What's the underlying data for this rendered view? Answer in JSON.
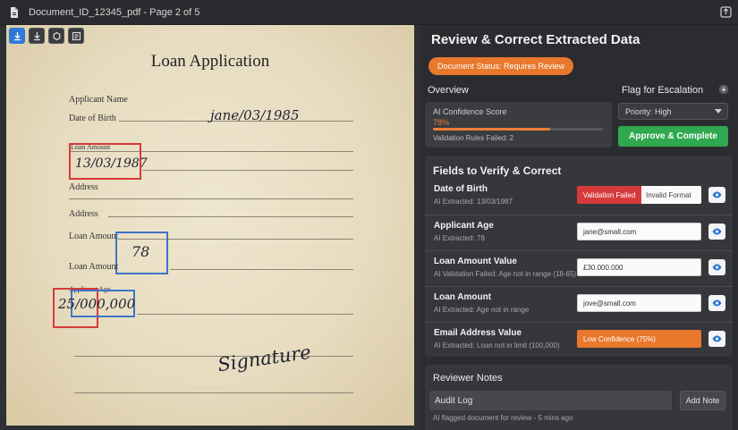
{
  "window": {
    "title": "Document_ID_12345_pdf - Page 2 of 5"
  },
  "document": {
    "title": "Loan Application",
    "labels": {
      "applicant_name": "Applicant Name",
      "date_of_birth": "Date of Birth",
      "loan_amount_small": "Loan Amount",
      "address_1": "Address",
      "address_2": "Address",
      "loan_amount_1": "Loan Amount",
      "loan_amount_2": "Loan Amount",
      "applicant_age": "Applicant Age"
    },
    "handwriting": {
      "dob_line": "jane/03/1985",
      "dob_boxed": "13/03/1987",
      "age_boxed": "78",
      "amount_boxed": "25/000,000",
      "signature": "Signature"
    }
  },
  "review": {
    "title": "Review & Correct Extracted Data",
    "status_badge": "Document Status: Requires Review",
    "overview": {
      "heading": "Overview",
      "confidence_label": "AI Confidence Score",
      "confidence_value": "78%",
      "confidence_fraction": 0.69,
      "validation_rules": "Validation Rules Failed: 2"
    },
    "escalation": {
      "heading": "Flag for Escalation",
      "priority_selected": "Priority: High",
      "approve_label": "Approve & Complete"
    },
    "fields": {
      "heading": "Fields to Verify & Correct",
      "rows": [
        {
          "name": "Date of Birth",
          "sub": "AI Extracted: 13/03/1987",
          "error": "Validation Failed",
          "value": "Invalid Format"
        },
        {
          "name": "Applicant Age",
          "sub": "AI Extracted: 78",
          "value": "jane@small.com"
        },
        {
          "name": "Loan Amount Value",
          "sub": "AI Validation Failed: Age not in range (18-65)",
          "value": "£30.000.000"
        },
        {
          "name": "Loan Amount",
          "sub": "AI Extracted: Age not in range",
          "value": "jove@small.com"
        },
        {
          "name": "Email Address Value",
          "sub": "AI Extracted: Loan not in limit (100,000)",
          "value": "Low Confidence (75%)"
        }
      ]
    },
    "notes": {
      "heading": "Reviewer Notes",
      "audit_log": "Audit Log",
      "add_note": "Add Note",
      "log_entry": "AI flagged document for review - 5 mins ago"
    }
  }
}
